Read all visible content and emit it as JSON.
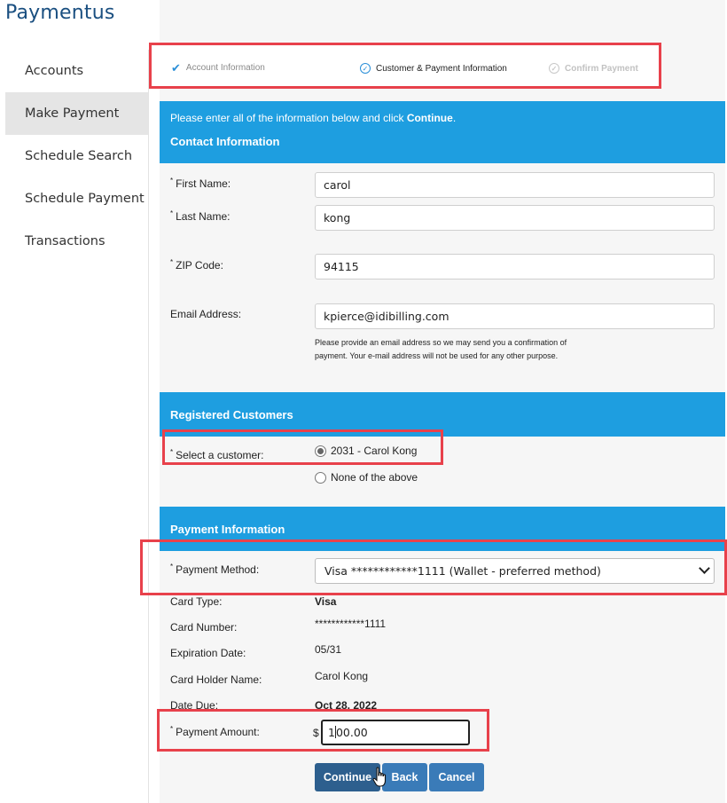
{
  "brand": "Paymentus",
  "sidebar": {
    "items": [
      {
        "label": "Accounts"
      },
      {
        "label": "Make Payment"
      },
      {
        "label": "Schedule Search"
      },
      {
        "label": "Schedule Payment"
      },
      {
        "label": "Transactions"
      }
    ],
    "active_index": 1
  },
  "steps": [
    {
      "label": "Account Information",
      "state": "done"
    },
    {
      "label": "Customer & Payment Information",
      "state": "current"
    },
    {
      "label": "Confirm Payment",
      "state": "pending"
    }
  ],
  "intro": {
    "prefix": "Please enter all of the information below and click ",
    "emphasis": "Continue",
    "suffix": "."
  },
  "contact": {
    "title": "Contact Information",
    "first_name": {
      "label": "First Name:",
      "value": "carol"
    },
    "last_name": {
      "label": "Last Name:",
      "value": "kong"
    },
    "zip": {
      "label": "ZIP Code:",
      "value": "94115"
    },
    "email": {
      "label": "Email Address:",
      "value": "kpierce@idibilling.com"
    },
    "email_hint": "Please provide an email address so we may send you a confirmation of payment. Your e-mail address will not be used for any other purpose."
  },
  "registered": {
    "title": "Registered Customers",
    "select_label": "Select a customer:",
    "options": [
      {
        "label": "2031 - Carol Kong",
        "checked": true
      },
      {
        "label": "None of the above",
        "checked": false
      }
    ]
  },
  "payment": {
    "title": "Payment Information",
    "method_label": "Payment Method:",
    "method_value": "Visa ************1111 (Wallet - preferred method)",
    "details": [
      {
        "label": "Card Type:",
        "value": "Visa"
      },
      {
        "label": "Card Number:",
        "value": "************1111"
      },
      {
        "label": "Expiration Date:",
        "value": "05/31"
      },
      {
        "label": "Card Holder Name:",
        "value": "Carol Kong"
      },
      {
        "label": "Date Due:",
        "value": "Oct 28, 2022"
      }
    ],
    "amount_label": "Payment Amount:",
    "currency": "$",
    "amount_before_caret": "1",
    "amount_after_caret": "00.00"
  },
  "buttons": {
    "continue": "Continue",
    "back": "Back",
    "cancel": "Cancel"
  },
  "required_mark": "*",
  "colors": {
    "banner": "#1e9ee0",
    "brand": "#1a4f80",
    "highlight": "#e8414b",
    "primary_button": "#2d5f8e",
    "secondary_button": "#3a7bb8"
  }
}
